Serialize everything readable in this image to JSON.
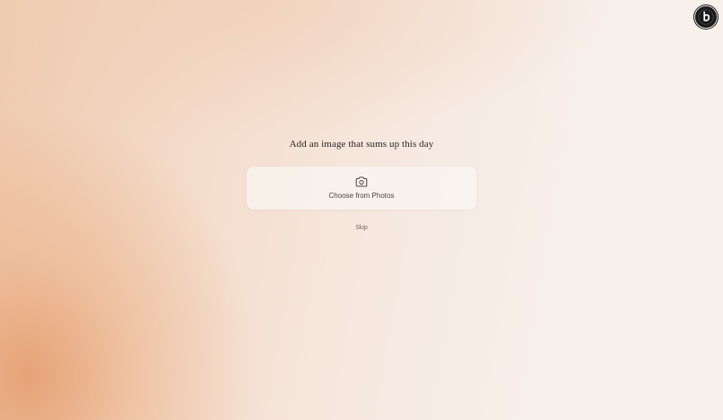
{
  "app": {
    "badge_icon": "b-logo-icon"
  },
  "main": {
    "prompt": "Add an image that sums up this day",
    "choose_button": {
      "icon": "camera-icon",
      "label": "Choose from Photos"
    },
    "skip_label": "Skip"
  },
  "colors": {
    "accent_warm": "#e6a073",
    "background": "#f8f0ec",
    "text_dark": "#2b2724",
    "text_muted": "#6e6863",
    "badge": "#1a1a1a"
  }
}
